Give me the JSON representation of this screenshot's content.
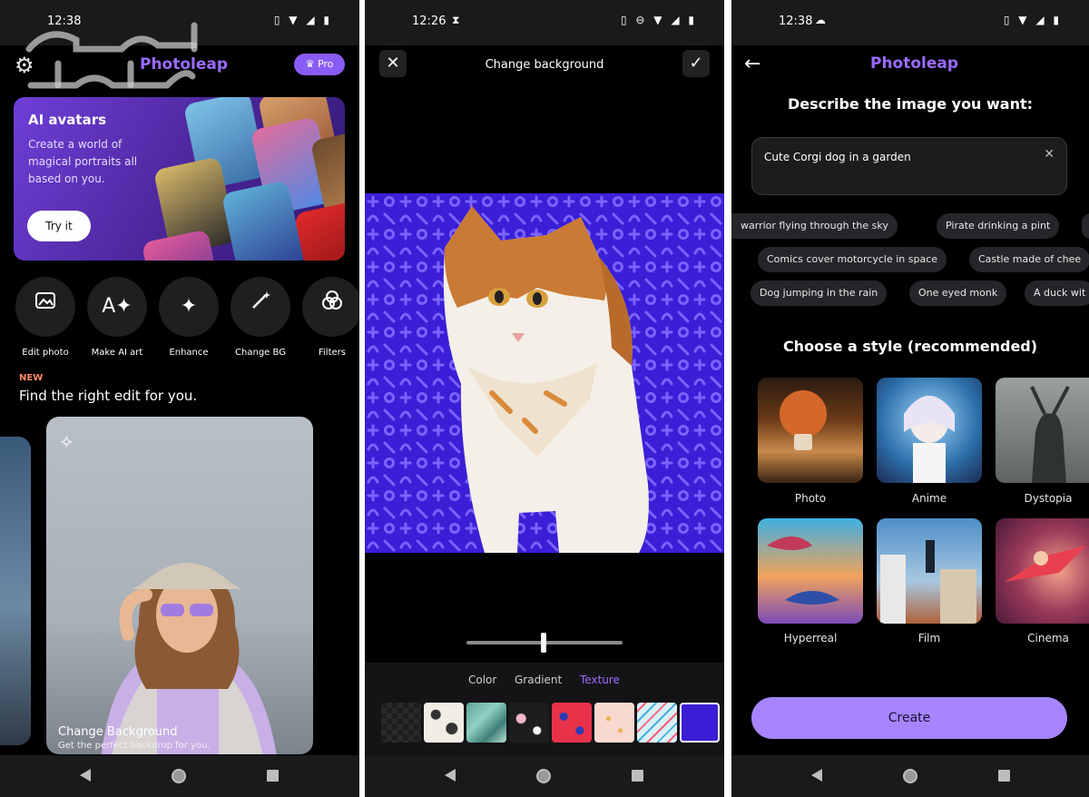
{
  "phone1": {
    "status": {
      "time": "12:38"
    },
    "watermark": "مستقبل وجديد",
    "header": {
      "brand": "Photoleap",
      "pro_label": "♛ Pro"
    },
    "ai_card": {
      "title": "AI avatars",
      "description": "Create a world of magical portraits all based on you.",
      "button": "Try it"
    },
    "tools": [
      {
        "label": "Edit photo",
        "icon": "image-icon"
      },
      {
        "label": "Make AI art",
        "icon": "ai-art-icon"
      },
      {
        "label": "Enhance",
        "icon": "sparkle-icon"
      },
      {
        "label": "Change BG",
        "icon": "magic-wand-icon"
      },
      {
        "label": "Filters",
        "icon": "filters-icon"
      }
    ],
    "section": {
      "new_label": "NEW",
      "title": "Find the right edit for you."
    },
    "feature_card": {
      "title": "Change Background",
      "subtitle": "Get the perfect backdrop for you."
    }
  },
  "phone2": {
    "status": {
      "time": "12:26"
    },
    "header": {
      "title": "Change background"
    },
    "tabs": [
      "Color",
      "Gradient",
      "Texture"
    ],
    "active_tab": "Texture",
    "swatch_colors": [
      "#2a2a2a",
      "#f2ede4",
      "#5ea59a",
      "#1d1d1f",
      "#e8324a",
      "#f8d9d0",
      "#d8f1f4",
      "#3b1fd6"
    ]
  },
  "phone3": {
    "status": {
      "time": "12:38"
    },
    "header": {
      "brand": "Photoleap"
    },
    "describe_title": "Describe the image you want:",
    "prompt_value": "Cute Corgi dog in a garden",
    "chips_row1": [
      "warrior flying through the sky",
      "Pirate drinking a pint"
    ],
    "chips_row2": [
      "Comics cover motorcycle in space",
      "Castle made of chee"
    ],
    "chips_row3": [
      "Dog jumping in the rain",
      "One eyed monk",
      "A duck wit"
    ],
    "choose_title": "Choose a style (recommended)",
    "styles": [
      "Photo",
      "Anime",
      "Dystopia",
      "Hyperreal",
      "Film",
      "Cinema"
    ],
    "create_label": "Create"
  },
  "colors": {
    "accent": "#9b6bff",
    "create_button": "#a685ff",
    "texture_bg": "#3b1fd6"
  }
}
